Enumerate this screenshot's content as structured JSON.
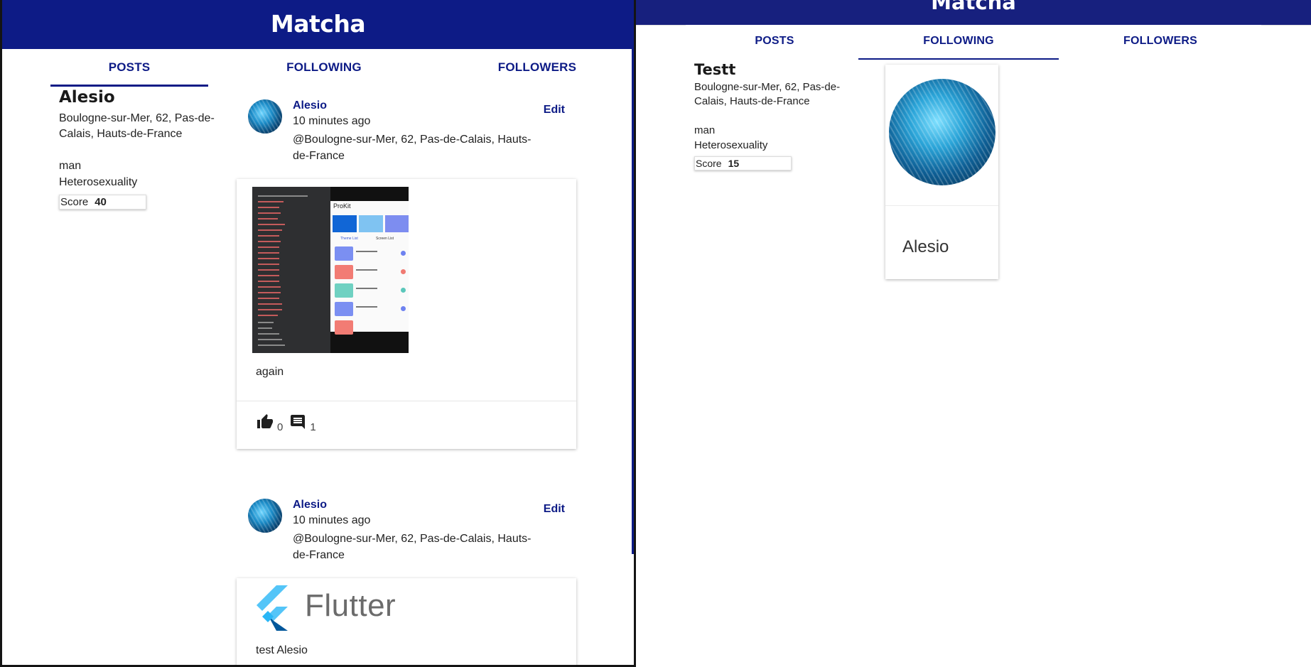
{
  "left": {
    "app_title": "Matcha",
    "tabs": [
      {
        "label": "POSTS",
        "active": true
      },
      {
        "label": "FOLLOWING",
        "active": false
      },
      {
        "label": "FOLLOWERS",
        "active": false
      }
    ],
    "profile": {
      "name": "Alesio",
      "location": "Boulogne-sur-Mer, 62, Pas-de-Calais, Hauts-de-France",
      "gender": "man",
      "orientation": "Heterosexuality",
      "score_label": "Score",
      "score_value": "40"
    },
    "posts": [
      {
        "author": "Alesio",
        "time": "10 minutes ago",
        "location": "@Boulogne-sur-Mer, 62, Pas-de-Calais, Hauts-de-France",
        "edit_label": "Edit",
        "image": {
          "app_title": "ProKit",
          "tab1": "Theme List",
          "tab2": "Screen List"
        },
        "caption": "again",
        "likes": "0",
        "comments": "1"
      },
      {
        "author": "Alesio",
        "time": "10 minutes ago",
        "location": "@Boulogne-sur-Mer, 62, Pas-de-Calais, Hauts-de-France",
        "edit_label": "Edit",
        "image": {
          "logo_word": "Flutter"
        },
        "caption": "test Alesio"
      }
    ]
  },
  "right": {
    "app_title": "Matcha",
    "tabs": [
      {
        "label": "POSTS",
        "active": false
      },
      {
        "label": "FOLLOWING",
        "active": true
      },
      {
        "label": "FOLLOWERS",
        "active": false
      }
    ],
    "profile": {
      "name": "Testt",
      "location": "Boulogne-sur-Mer, 62, Pas-de-Calais, Hauts-de-France",
      "gender": "man",
      "orientation": "Heterosexuality",
      "score_label": "Score",
      "score_value": "15"
    },
    "following": [
      {
        "name": "Alesio"
      }
    ]
  },
  "colors": {
    "appbar": "#0d1b86",
    "accent": "#0d1b86",
    "text": "#222222"
  },
  "icons": [
    "thumb-up-icon",
    "comment-icon",
    "avatar-image",
    "flutter-logo"
  ]
}
